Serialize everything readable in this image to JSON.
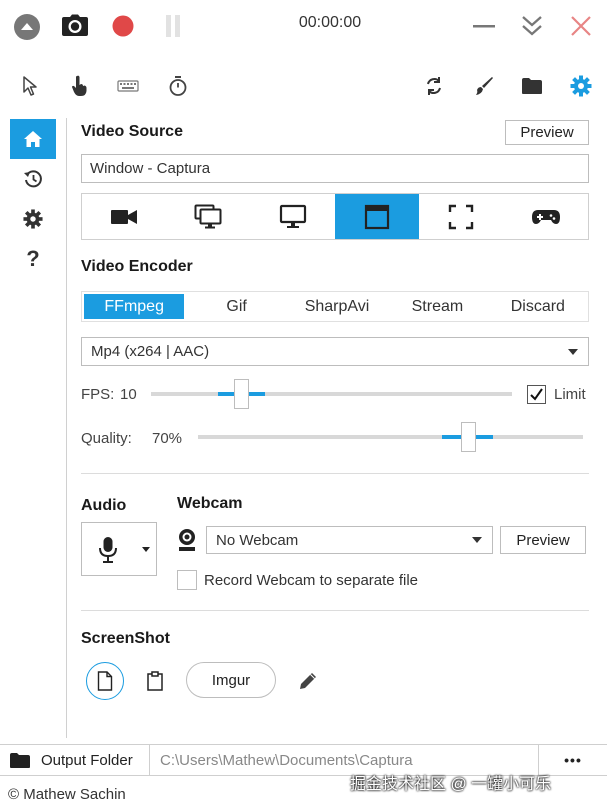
{
  "window": {
    "timer": "00:00:00"
  },
  "icons": {
    "collapse": "chevron-up-circle-icon",
    "screenshot": "camera-icon",
    "record": "record-icon",
    "pause": "pause-icon",
    "minimize": "minimize-icon",
    "to_tray": "double-chevron-down-icon",
    "close": "close-icon"
  },
  "toolbar": {
    "left": [
      "mouse-pointer-icon",
      "mouse-click-icon",
      "keystrokes-icon",
      "timer-icon"
    ],
    "right": [
      "refresh-icon",
      "brush-icon",
      "folder-icon",
      "settings-icon"
    ]
  },
  "sidebar": {
    "items": [
      {
        "name": "home-icon",
        "active": true
      },
      {
        "name": "history-icon",
        "active": false
      },
      {
        "name": "settings-icon",
        "active": false
      },
      {
        "name": "help-icon",
        "active": false,
        "label": "?"
      }
    ]
  },
  "video_source": {
    "heading": "Video Source",
    "preview_label": "Preview",
    "selected_value": "Window  -  Captura",
    "sources": [
      {
        "name": "webcam-source-icon",
        "active": false
      },
      {
        "name": "multi-screen-source-icon",
        "active": false
      },
      {
        "name": "screen-source-icon",
        "active": false
      },
      {
        "name": "window-source-icon",
        "active": true
      },
      {
        "name": "region-source-icon",
        "active": false
      },
      {
        "name": "gamepad-source-icon",
        "active": false
      }
    ]
  },
  "video_encoder": {
    "heading": "Video Encoder",
    "tabs": [
      "FFmpeg",
      "Gif",
      "SharpAvi",
      "Stream",
      "Discard"
    ],
    "active_tab": 0,
    "codec_value": "Mp4 (x264 | AAC)",
    "fps_label": "FPS:",
    "fps_value": "10",
    "fps_fraction": 0.25,
    "limit_label": "Limit",
    "limit_checked": true,
    "quality_label": "Quality:",
    "quality_value": "70%",
    "quality_fraction": 0.7
  },
  "audio": {
    "heading": "Audio"
  },
  "webcam": {
    "heading": "Webcam",
    "selected_value": "No Webcam",
    "preview_label": "Preview",
    "separate_file_label": "Record Webcam to separate file",
    "separate_file_checked": false
  },
  "screenshot": {
    "heading": "ScreenShot",
    "imgur_label": "Imgur"
  },
  "footer": {
    "output_folder_label": "Output Folder",
    "output_path": "C:\\Users\\Mathew\\Documents\\Captura",
    "more_label": "•••",
    "copyright": "© Mathew Sachin"
  },
  "watermark": {
    "text": "掘金技术社区 @ 一罐小可乐"
  },
  "colors": {
    "accent": "#1b9ce0",
    "record": "#e04848",
    "close": "#e88585"
  }
}
